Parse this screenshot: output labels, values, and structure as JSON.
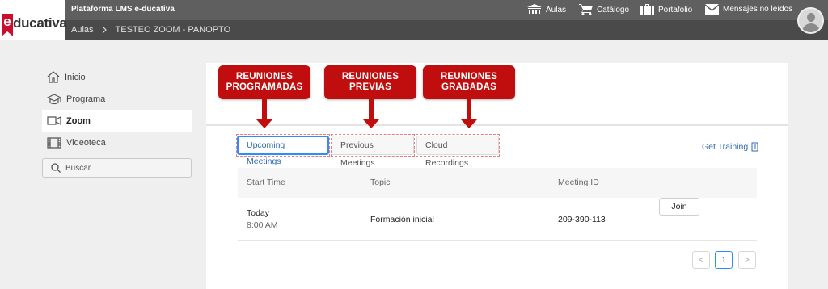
{
  "header": {
    "logo_letter": "e",
    "logo_word": "ducativa",
    "platform_title": "Plataforma LMS e-ducativa",
    "breadcrumb": [
      "Aulas",
      "TESTEO ZOOM - PANOPTO"
    ],
    "nav": [
      {
        "label": "Aulas",
        "icon": "institution-icon"
      },
      {
        "label": "Catálogo",
        "icon": "cart-icon"
      },
      {
        "label": "Portafolio",
        "icon": "briefcase-icon"
      },
      {
        "label": "Mensajes no leídos",
        "icon": "envelope-icon"
      }
    ]
  },
  "sidebar": {
    "items": [
      {
        "label": "Inicio",
        "icon": "home-icon"
      },
      {
        "label": "Programa",
        "icon": "graduation-cap-icon"
      },
      {
        "label": "Zoom",
        "icon": "video-camera-icon",
        "active": true
      },
      {
        "label": "Videoteca",
        "icon": "film-icon"
      }
    ],
    "search_placeholder": "Buscar"
  },
  "callouts": [
    {
      "text": "REUNIONES PROGRAMADAS"
    },
    {
      "text": "REUNIONES PREVIAS"
    },
    {
      "text": "REUNIONES GRABADAS"
    }
  ],
  "tabs": [
    {
      "label": "Upcoming Meetings",
      "active": true
    },
    {
      "label": "Previous Meetings"
    },
    {
      "label": "Cloud Recordings"
    }
  ],
  "get_training": "Get Training",
  "table": {
    "columns": [
      "Start Time",
      "Topic",
      "Meeting ID"
    ],
    "rows": [
      {
        "day": "Today",
        "time": "8:00 AM",
        "topic": "Formación inicial",
        "meeting_id": "209-390-113",
        "action": "Join"
      }
    ]
  },
  "pagination": {
    "prev": "<",
    "current": "1",
    "next": ">"
  },
  "colors": {
    "accent": "#2d8cff",
    "callout": "#c00d0d",
    "brand": "#c8102e"
  }
}
